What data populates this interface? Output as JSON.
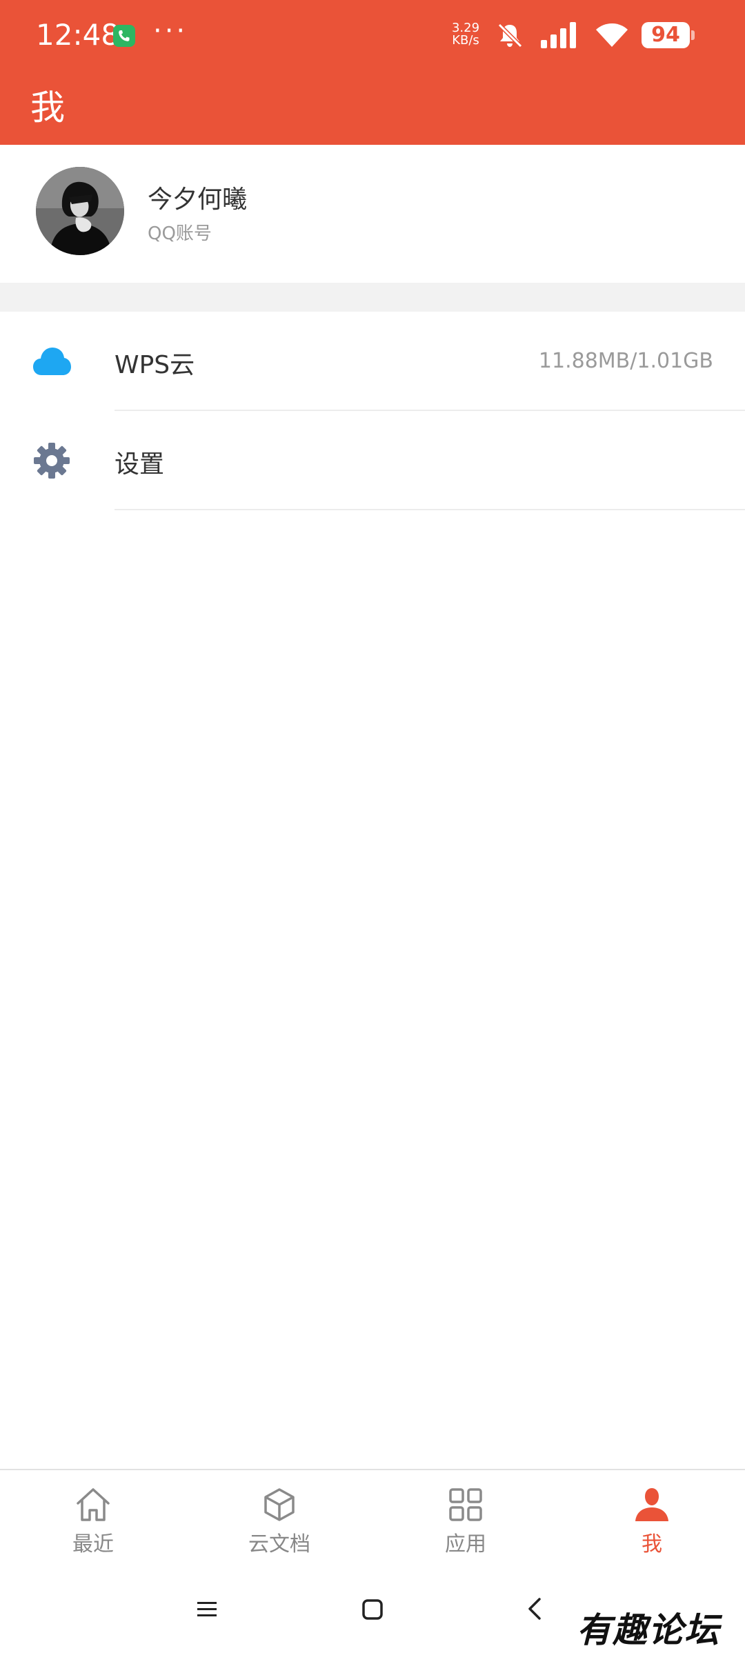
{
  "status_bar": {
    "time": "12:48",
    "net_speed_value": "3.29",
    "net_speed_unit": "KB/s",
    "battery": "94",
    "icons": [
      "phone-icon",
      "more-dots-icon",
      "bell-muted-icon",
      "signal-icon",
      "wifi-icon",
      "battery-icon"
    ]
  },
  "header": {
    "title": "我"
  },
  "profile": {
    "name": "今夕何曦",
    "account_type": "QQ账号"
  },
  "menu": {
    "items": [
      {
        "icon": "cloud-icon",
        "label": "WPS云",
        "value": "11.88MB/1.01GB",
        "icon_color": "#1ea7f2"
      },
      {
        "icon": "gear-icon",
        "label": "设置",
        "value": "",
        "icon_color": "#6b7891"
      }
    ]
  },
  "tabbar": {
    "items": [
      {
        "icon": "home-icon",
        "label": "最近",
        "active": false
      },
      {
        "icon": "cube-icon",
        "label": "云文档",
        "active": false
      },
      {
        "icon": "apps-grid-icon",
        "label": "应用",
        "active": false
      },
      {
        "icon": "person-icon",
        "label": "我",
        "active": true
      }
    ]
  },
  "navbar": {
    "icons": [
      "menu-icon",
      "home-square-icon",
      "back-chevron-icon"
    ]
  },
  "watermark": {
    "text": "有趣论坛"
  },
  "colors": {
    "accent": "#ea5338",
    "header_bg": "#ea5338",
    "section_gap": "#f2f2f2",
    "text_primary": "#333333",
    "text_secondary": "#9a9a9a",
    "tab_inactive": "#888888"
  }
}
